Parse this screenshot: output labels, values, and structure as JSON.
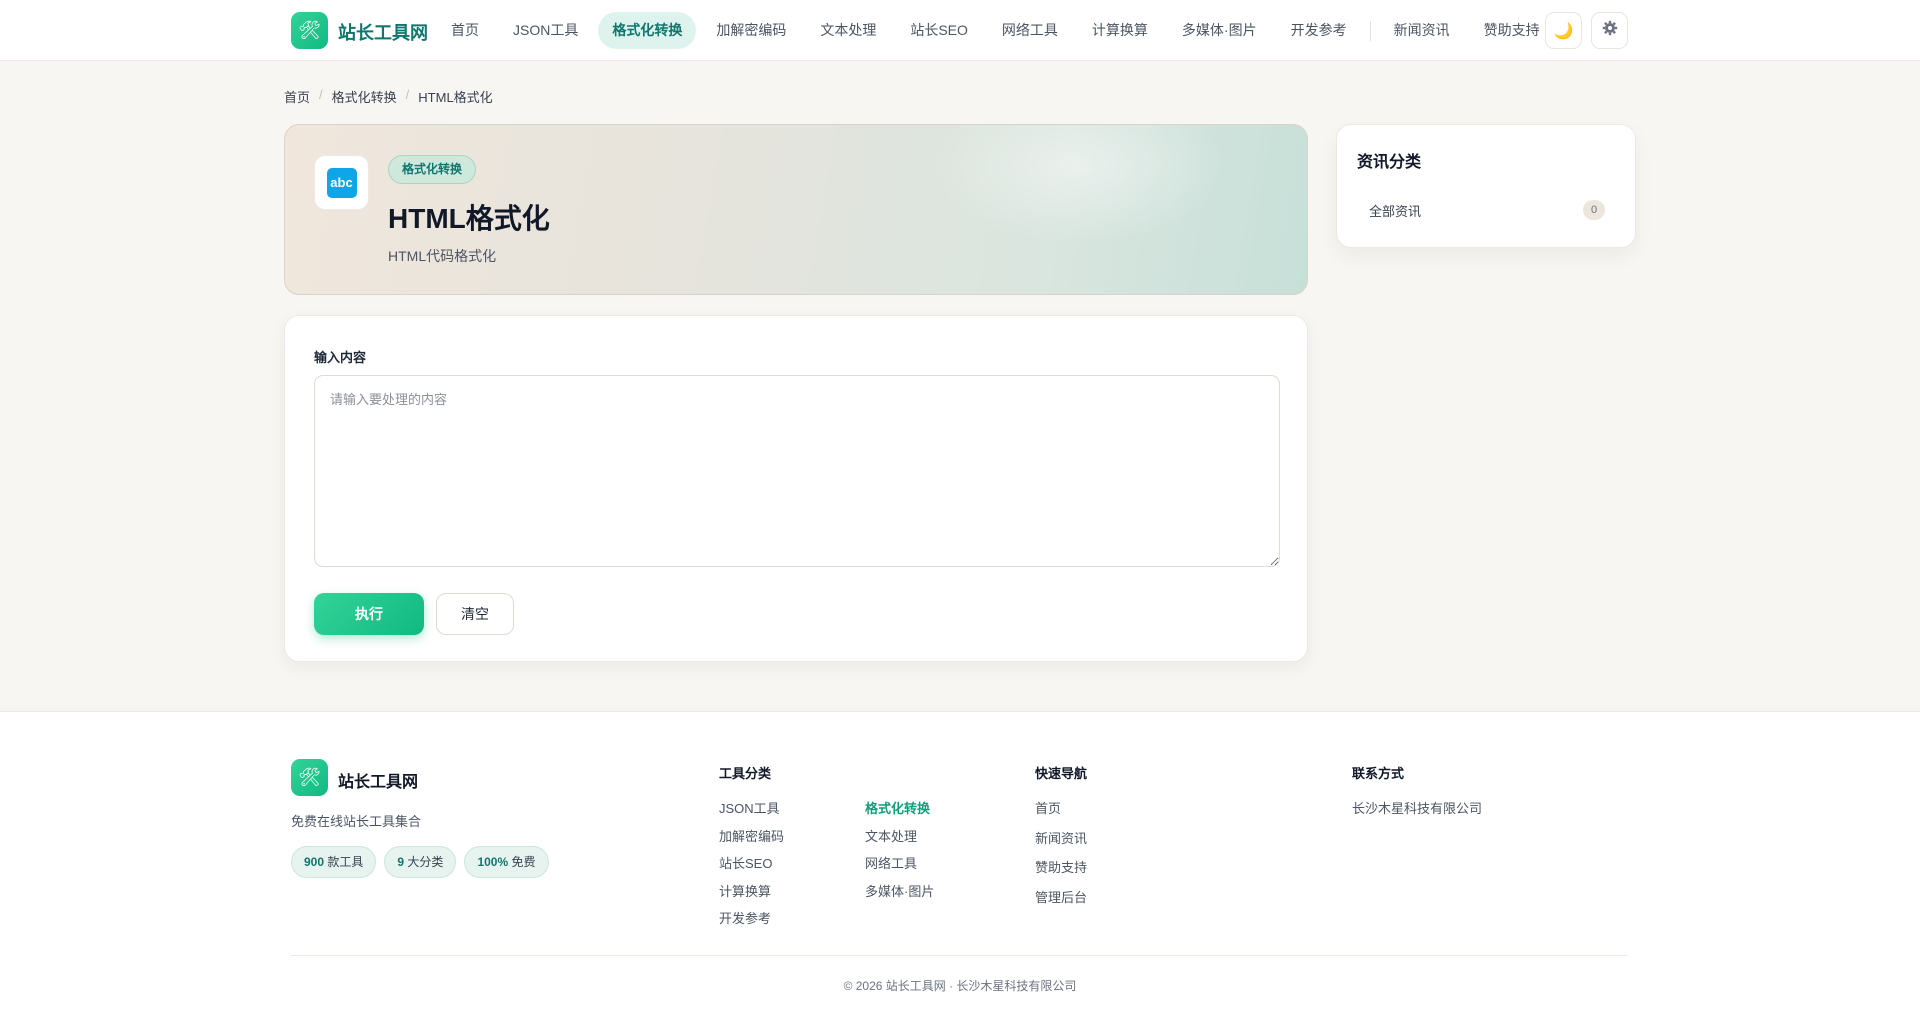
{
  "site": {
    "name": "站长工具网",
    "logo_icon": "hammer-wrench-icon",
    "accent_color": "#10b981",
    "brand_text_color": "#0f766e"
  },
  "nav": {
    "items": [
      {
        "label": "首页",
        "active": false
      },
      {
        "label": "JSON工具",
        "active": false
      },
      {
        "label": "格式化转换",
        "active": true
      },
      {
        "label": "加解密编码",
        "active": false
      },
      {
        "label": "文本处理",
        "active": false
      },
      {
        "label": "站长SEO",
        "active": false
      },
      {
        "label": "网络工具",
        "active": false
      },
      {
        "label": "计算换算",
        "active": false
      },
      {
        "label": "多媒体·图片",
        "active": false
      },
      {
        "label": "开发参考",
        "active": false
      },
      {
        "label": "新闻资讯",
        "active": false
      },
      {
        "label": "赞助支持",
        "active": false
      }
    ],
    "theme_toggle_icon": "moon-icon",
    "settings_icon": "gear-icon"
  },
  "breadcrumb": [
    "首页",
    "格式化转换",
    "HTML格式化"
  ],
  "hero": {
    "icon_text": "abc",
    "badge": "格式化转换",
    "title": "HTML格式化",
    "subtitle": "HTML代码格式化"
  },
  "tool": {
    "input_label": "输入内容",
    "input_placeholder": "请输入要处理的内容",
    "input_value": "",
    "run_button": "执行",
    "clear_button": "清空"
  },
  "sidebar": {
    "title": "资讯分类",
    "categories": [
      {
        "label": "全部资讯",
        "count": "0"
      }
    ]
  },
  "footer": {
    "name": "站长工具网",
    "description": "免费在线站长工具集合",
    "stats": [
      {
        "value": "900",
        "label": "款工具"
      },
      {
        "value": "9",
        "label": "大分类"
      },
      {
        "value": "100%",
        "label": "免费"
      }
    ],
    "categories_title": "工具分类",
    "categories_col1": [
      "JSON工具",
      "加解密编码",
      "站长SEO",
      "计算换算",
      "开发参考"
    ],
    "categories_col2": [
      "格式化转换",
      "文本处理",
      "网络工具",
      "多媒体·图片"
    ],
    "quicknav_title": "快速导航",
    "quicknav": [
      "首页",
      "新闻资讯",
      "赞助支持",
      "管理后台"
    ],
    "contact_title": "联系方式",
    "contact": [
      "长沙木星科技有限公司"
    ],
    "copyright": "© 2026 站长工具网 · 长沙木星科技有限公司"
  }
}
